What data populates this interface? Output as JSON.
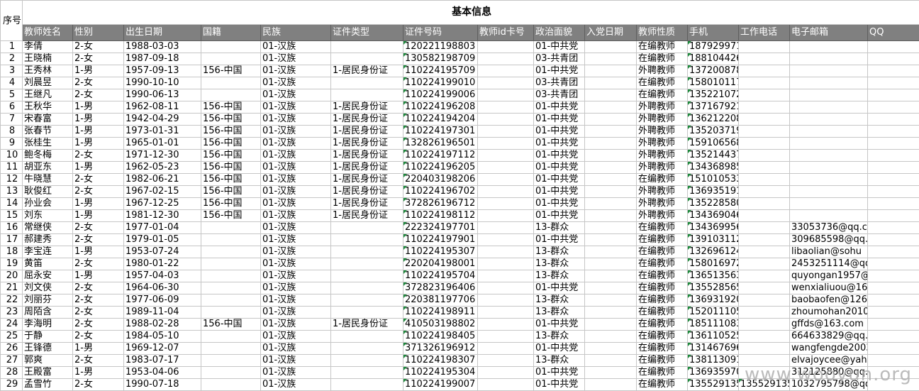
{
  "sheet": {
    "corner_label": "序号",
    "title": "基本信息",
    "headers": [
      "教师姓名",
      "性别",
      "出生日期",
      "国籍",
      "民族",
      "证件类型",
      "证件号码",
      "教师id卡号",
      "政治面貌",
      "入党日期",
      "教师性质",
      "手机",
      "工作电话",
      "电子邮箱",
      "QQ"
    ],
    "rows": [
      {
        "no": "1",
        "cells": [
          "李倩",
          "2-女",
          "1988-03-03",
          "",
          "01-汉族",
          "",
          "120221198803",
          "",
          "01-中共党",
          "",
          "在编教师",
          "187929971",
          "",
          "",
          ""
        ]
      },
      {
        "no": "2",
        "cells": [
          "王晓楠",
          "2-女",
          "1987-09-18",
          "",
          "01-汉族",
          "",
          "130582198709",
          "",
          "03-共青团",
          "",
          "在编教师",
          "188104426",
          "",
          "",
          ""
        ]
      },
      {
        "no": "3",
        "cells": [
          "王秀林",
          "1-男",
          "1957-09-13",
          "156-中国",
          "01-汉族",
          "1-居民身份证",
          "110224195709",
          "",
          "01-中共党",
          "",
          "外聘教师",
          "137200878",
          "",
          "",
          ""
        ]
      },
      {
        "no": "4",
        "cells": [
          "刘晨昱",
          "2-女",
          "1990-10-10",
          "",
          "01-汉族",
          "",
          "110224199010",
          "",
          "03-共青团",
          "",
          "在编教师",
          "158010117",
          "",
          "",
          ""
        ]
      },
      {
        "no": "5",
        "cells": [
          "王继凡",
          "2-女",
          "1990-06-13",
          "",
          "01-汉族",
          "",
          "110224199006",
          "",
          "03-共青团",
          "",
          "在编教师",
          "135221072",
          "",
          "",
          ""
        ]
      },
      {
        "no": "6",
        "cells": [
          "王秋华",
          "1-男",
          "1962-08-11",
          "156-中国",
          "01-汉族",
          "1-居民身份证",
          "110224196208",
          "",
          "01-中共党",
          "",
          "外聘教师",
          "137167921",
          "",
          "",
          ""
        ]
      },
      {
        "no": "7",
        "cells": [
          "宋春富",
          "1-男",
          "1942-04-29",
          "156-中国",
          "01-汉族",
          "1-居民身份证",
          "110224194204",
          "",
          "01-中共党",
          "",
          "外聘教师",
          "136212208",
          "",
          "",
          ""
        ]
      },
      {
        "no": "8",
        "cells": [
          "张春节",
          "1-男",
          "1973-01-31",
          "156-中国",
          "01-汉族",
          "1-居民身份证",
          "110224197301",
          "",
          "01-中共党",
          "",
          "外聘教师",
          "135203719",
          "",
          "",
          ""
        ]
      },
      {
        "no": "9",
        "cells": [
          "张桂生",
          "1-男",
          "1965-01-01",
          "156-中国",
          "01-汉族",
          "1-居民身份证",
          "132826196501",
          "",
          "01-中共党",
          "",
          "外聘教师",
          "159106568",
          "",
          "",
          ""
        ]
      },
      {
        "no": "10",
        "cells": [
          "鲍冬梅",
          "2-女",
          "1971-12-30",
          "156-中国",
          "01-汉族",
          "1-居民身份证",
          "110224197112",
          "",
          "01-中共党",
          "",
          "外聘教师",
          "135214437",
          "",
          "",
          ""
        ]
      },
      {
        "no": "11",
        "cells": [
          "胡亚东",
          "1-男",
          "1962-05-23",
          "156-中国",
          "01-汉族",
          "1-居民身份证",
          "110224196205",
          "",
          "01-中共党",
          "",
          "外聘教师",
          "134368985",
          "",
          "",
          ""
        ]
      },
      {
        "no": "12",
        "cells": [
          "牛晓慧",
          "2-女",
          "1982-06-21",
          "156-中国",
          "01-汉族",
          "1-居民身份证",
          "220403198206",
          "",
          "01-中共党",
          "",
          "在编教师",
          "151010533",
          "",
          "",
          ""
        ]
      },
      {
        "no": "13",
        "cells": [
          "耿俊红",
          "2-女",
          "1967-02-15",
          "156-中国",
          "01-汉族",
          "1-居民身份证",
          "110224196702",
          "",
          "01-中共党",
          "",
          "外聘教师",
          "136935191",
          "",
          "",
          ""
        ]
      },
      {
        "no": "14",
        "cells": [
          "孙业会",
          "1-男",
          "1967-12-25",
          "156-中国",
          "01-汉族",
          "1-居民身份证",
          "372826196712",
          "",
          "01-中共党",
          "",
          "外聘教师",
          "135228580",
          "",
          "",
          ""
        ]
      },
      {
        "no": "15",
        "cells": [
          "刘东",
          "1-男",
          "1981-12-30",
          "156-中国",
          "01-汉族",
          "1-居民身份证",
          "110224198112",
          "",
          "01-中共党",
          "",
          "外聘教师",
          "134369046",
          "",
          "",
          ""
        ]
      },
      {
        "no": "16",
        "cells": [
          "常继侠",
          "2-女",
          "1977-01-04",
          "",
          "01-汉族",
          "",
          "222324197701",
          "",
          "13-群众",
          "",
          "在编教师",
          "134369956",
          "",
          "33053736@qq.co",
          ""
        ]
      },
      {
        "no": "17",
        "cells": [
          "郝建秀",
          "2-女",
          "1979-01-05",
          "",
          "01-汉族",
          "",
          "110224197901",
          "",
          "01-中共党",
          "",
          "在编教师",
          "139103112",
          "",
          "309685598@qq.c",
          ""
        ]
      },
      {
        "no": "18",
        "cells": [
          "李宝连",
          "1-男",
          "1953-07-24",
          "",
          "01-汉族",
          "",
          "110224195307",
          "",
          "13-群众",
          "",
          "在编教师",
          "132696124",
          "",
          "libaolian@sohu",
          ""
        ]
      },
      {
        "no": "19",
        "cells": [
          "黄笛",
          "2-女",
          "1980-01-22",
          "",
          "01-汉族",
          "",
          "220204198001",
          "",
          "13-群众",
          "",
          "在编教师",
          "158016972",
          "",
          "2453251114@qq.",
          ""
        ]
      },
      {
        "no": "20",
        "cells": [
          "屈永安",
          "1-男",
          "1957-04-03",
          "",
          "01-汉族",
          "",
          "110224195704",
          "",
          "13-群众",
          "",
          "在编教师",
          "136513563",
          "",
          "quyongan1957@1",
          ""
        ]
      },
      {
        "no": "21",
        "cells": [
          "刘文侠",
          "2-女",
          "1964-06-30",
          "",
          "01-汉族",
          "",
          "372823196406",
          "",
          "01-中共党",
          "",
          "在编教师",
          "135528565",
          "",
          "wenxialiuou@16",
          ""
        ]
      },
      {
        "no": "22",
        "cells": [
          "刘丽芬",
          "2-女",
          "1977-06-09",
          "",
          "01-汉族",
          "",
          "220381197706",
          "",
          "13-群众",
          "",
          "在编教师",
          "136931920",
          "",
          "baobaofen@126.",
          ""
        ]
      },
      {
        "no": "23",
        "cells": [
          "周陌含",
          "2-女",
          "1989-11-04",
          "",
          "01-汉族",
          "",
          "110224198911",
          "",
          "13-群众",
          "",
          "在编教师",
          "152011105",
          "",
          "zhoumohan2010@",
          ""
        ]
      },
      {
        "no": "24",
        "cells": [
          "李海明",
          "2-女",
          "1988-02-28",
          "156-中国",
          "01-汉族",
          "1-居民身份证",
          "410503198802",
          "",
          "01-中共党",
          "",
          "在编教师",
          "185111083",
          "",
          "gffds@163.com",
          ""
        ]
      },
      {
        "no": "25",
        "cells": [
          "于静",
          "2-女",
          "1984-05-10",
          "",
          "01-汉族",
          "",
          "110224198405",
          "",
          "13-群众",
          "",
          "在编教师",
          "136110525",
          "",
          "664633829@qq.c",
          ""
        ]
      },
      {
        "no": "26",
        "cells": [
          "王锋德",
          "1-男",
          "1969-12-07",
          "",
          "01-汉族",
          "",
          "371326196912",
          "",
          "01-中共党",
          "",
          "在编教师",
          "131467696",
          "",
          "wangfengde2003",
          ""
        ]
      },
      {
        "no": "27",
        "cells": [
          "郭爽",
          "2-女",
          "1983-07-17",
          "",
          "01-汉族",
          "",
          "110224198307",
          "",
          "13-群众",
          "",
          "在编教师",
          "138113091",
          "",
          "elvajoycee@yah",
          ""
        ]
      },
      {
        "no": "28",
        "cells": [
          "王殿富",
          "1-男",
          "1953-04-06",
          "",
          "01-汉族",
          "",
          "110224195304",
          "",
          "01-中共党",
          "",
          "在编教师",
          "136935970",
          "",
          "312125880@qq.c",
          ""
        ]
      },
      {
        "no": "29",
        "cells": [
          "孟雪竹",
          "2-女",
          "1990-07-18",
          "",
          "01-汉族",
          "",
          "110224199007",
          "",
          "01-中共党",
          "",
          "在编教师",
          "135529135",
          "135529135",
          "1032795798@qq.",
          ""
        ]
      }
    ]
  },
  "watermark": "www.wooyun.org",
  "colors": {
    "header_bg": "#808080",
    "header_text": "#ffffff",
    "grid": "#c6c6c6",
    "error_marker": "#1d8a3c"
  }
}
